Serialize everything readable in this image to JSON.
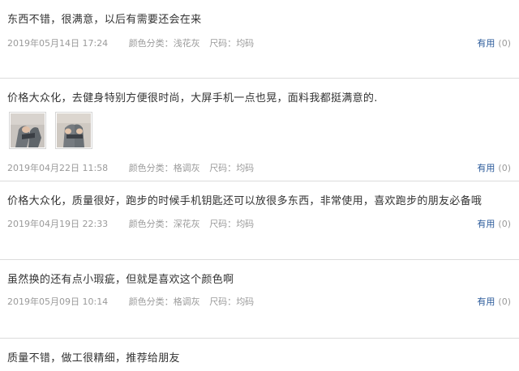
{
  "reviews": [
    {
      "text": "东西不错，很满意，以后有需要还会在来",
      "date": "2019年05月14日 17:24",
      "sku_color_label": "颜色分类：",
      "sku_color": "浅花灰",
      "sku_size_label": "尺码：",
      "sku_size": "均码",
      "useful_label": "有用",
      "useful_count": "(0)"
    },
    {
      "text": "价格大众化，去健身特别方便很时尚，大屏手机一点也晃，面料我都挺满意的.",
      "photos": [
        "review-photo-1",
        "review-photo-2"
      ],
      "date": "2019年04月22日 11:58",
      "sku_color_label": "颜色分类：",
      "sku_color": "格调灰",
      "sku_size_label": "尺码：",
      "sku_size": "均码",
      "useful_label": "有用",
      "useful_count": "(0)"
    },
    {
      "text": "价格大众化，质量很好，跑步的时候手机钥匙还可以放很多东西，非常使用，喜欢跑步的朋友必备哦",
      "date": "2019年04月19日 22:33",
      "sku_color_label": "颜色分类：",
      "sku_color": "深花灰",
      "sku_size_label": "尺码：",
      "sku_size": "均码",
      "useful_label": "有用",
      "useful_count": "(0)"
    },
    {
      "text": "虽然换的还有点小瑕疵，但就是喜欢这个颜色啊",
      "date": "2019年05月09日 10:14",
      "sku_color_label": "颜色分类：",
      "sku_color": "格调灰",
      "sku_size_label": "尺码：",
      "sku_size": "均码",
      "useful_label": "有用",
      "useful_count": "(0)"
    },
    {
      "text": "质量不错，做工很精细，推荐给朋友"
    }
  ],
  "colors": {
    "text": "#333333",
    "meta": "#9a9a9a",
    "link": "#2a5a9a",
    "divider": "#dcdcdc"
  }
}
